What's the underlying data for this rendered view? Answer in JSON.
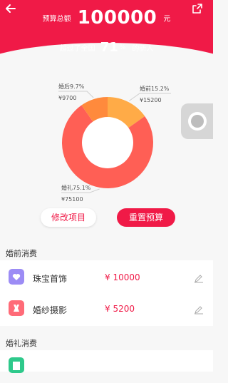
{
  "header": {
    "budget_label": "预算总额",
    "budget_value": "100000",
    "budget_unit": "元",
    "rank_prefix": "超过了全国",
    "rank_value": "71",
    "rank_unit": "%",
    "rank_suffix": "的新人"
  },
  "chart_data": {
    "type": "pie",
    "donut": true,
    "slices": [
      {
        "name": "婚礼",
        "percent": 75.1,
        "value": 75100,
        "label": "婚礼75.1%",
        "amount_label": "¥75100",
        "color": "#ff5f55"
      },
      {
        "name": "婚前",
        "percent": 15.2,
        "value": 15200,
        "label": "婚前15.2%",
        "amount_label": "¥15200",
        "color": "#ffab47"
      },
      {
        "name": "婚后",
        "percent": 9.7,
        "value": 9700,
        "label": "婚后9.7%",
        "amount_label": "¥9700",
        "color": "#ff8a3c"
      }
    ]
  },
  "actions": {
    "edit_label": "修改项目",
    "reset_label": "重置预算"
  },
  "sections": [
    {
      "title": "婚前消费",
      "items": [
        {
          "name": "珠宝首饰",
          "amount": "¥ 10000",
          "icon": "heart-icon",
          "color": "#9c8cf5"
        },
        {
          "name": "婚纱摄影",
          "amount": "¥ 5200",
          "icon": "dress-icon",
          "color": "#ff6b78"
        }
      ]
    },
    {
      "title": "婚礼消费",
      "items": [
        {
          "name": "",
          "amount": "",
          "icon": "book-icon",
          "color": "#2ec98b"
        }
      ]
    }
  ]
}
